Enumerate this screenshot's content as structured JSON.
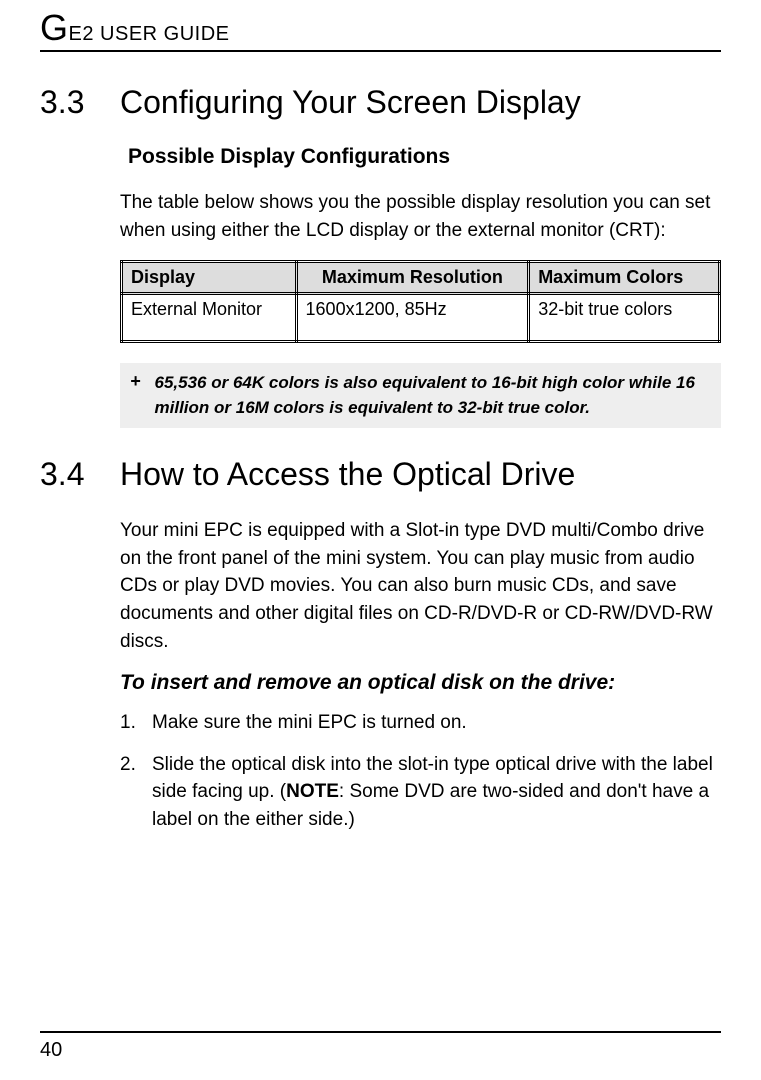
{
  "header": {
    "big": "G",
    "rest": "E2 USER GUIDE"
  },
  "sec33": {
    "num": "3.3",
    "title": "Configuring Your Screen Display",
    "sub": "Possible Display Configurations",
    "para": "The table below shows you the possible display resolution you can set when using either the LCD display or the external monitor (CRT):",
    "table": {
      "h1": "Display",
      "h2": "Maximum Resolution",
      "h3": "Maximum Colors",
      "r1c1": "External Monitor",
      "r1c2": "1600x1200, 85Hz",
      "r1c3": "32-bit true colors"
    },
    "note_mark": "+",
    "note": "65,536 or 64K colors is also equivalent to 16-bit high color while 16 million or 16M colors is equivalent to 32-bit true color."
  },
  "sec34": {
    "num": "3.4",
    "title": "How to Access the Optical Drive",
    "para": "Your mini EPC is equipped with a Slot-in type DVD multi/Combo drive on the front panel of the mini system. You can play music from audio CDs or play DVD movies. You can also burn music CDs, and save documents and other digital files on CD-R/DVD-R or CD-RW/DVD-RW discs.",
    "task": "To insert and remove an optical disk on the drive:",
    "step1_num": "1.",
    "step1": "Make sure the mini EPC is turned on.",
    "step2_num": "2.",
    "step2_a": "Slide the optical disk into the slot-in type optical drive with the label side facing up. (",
    "step2_note": "NOTE",
    "step2_b": ": Some DVD are two-sided and don't have a label on the either side.)"
  },
  "footer": {
    "page": "40"
  }
}
